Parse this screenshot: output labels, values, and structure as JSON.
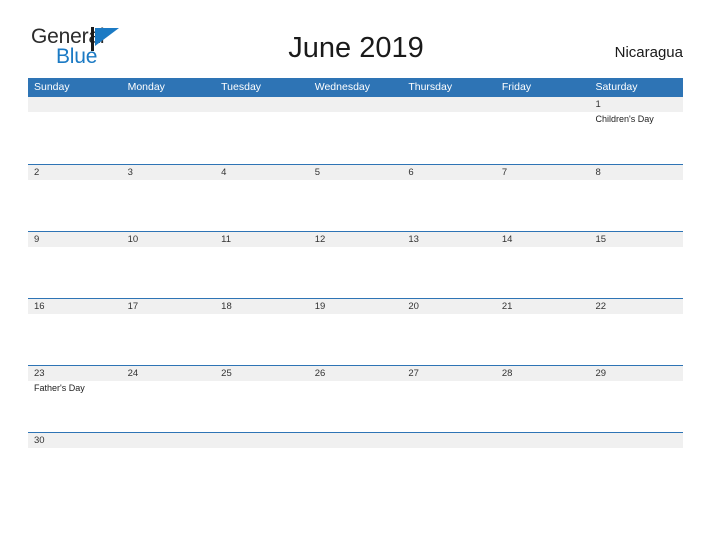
{
  "brand": {
    "name_part1": "General",
    "name_part2": "Blue",
    "flag_icon": "blue-pennant-flag-icon",
    "color_primary": "#1b7ac4",
    "color_text": "#2b2b2b"
  },
  "header": {
    "title": "June 2019",
    "country": "Nicaragua"
  },
  "theme": {
    "header_blue": "#2e74b5",
    "row_divider_blue": "#2e74b5",
    "daynum_band_gray": "#f0f0f0",
    "page_background": "#ffffff"
  },
  "calendar": {
    "month": "June",
    "year": "2019",
    "weekdays": [
      "Sunday",
      "Monday",
      "Tuesday",
      "Wednesday",
      "Thursday",
      "Friday",
      "Saturday"
    ],
    "weeks": [
      {
        "days": [
          {
            "num": "",
            "events": []
          },
          {
            "num": "",
            "events": []
          },
          {
            "num": "",
            "events": []
          },
          {
            "num": "",
            "events": []
          },
          {
            "num": "",
            "events": []
          },
          {
            "num": "",
            "events": []
          },
          {
            "num": "1",
            "events": [
              "Children's Day"
            ]
          }
        ]
      },
      {
        "days": [
          {
            "num": "2",
            "events": []
          },
          {
            "num": "3",
            "events": []
          },
          {
            "num": "4",
            "events": []
          },
          {
            "num": "5",
            "events": []
          },
          {
            "num": "6",
            "events": []
          },
          {
            "num": "7",
            "events": []
          },
          {
            "num": "8",
            "events": []
          }
        ]
      },
      {
        "days": [
          {
            "num": "9",
            "events": []
          },
          {
            "num": "10",
            "events": []
          },
          {
            "num": "11",
            "events": []
          },
          {
            "num": "12",
            "events": []
          },
          {
            "num": "13",
            "events": []
          },
          {
            "num": "14",
            "events": []
          },
          {
            "num": "15",
            "events": []
          }
        ]
      },
      {
        "days": [
          {
            "num": "16",
            "events": []
          },
          {
            "num": "17",
            "events": []
          },
          {
            "num": "18",
            "events": []
          },
          {
            "num": "19",
            "events": []
          },
          {
            "num": "20",
            "events": []
          },
          {
            "num": "21",
            "events": []
          },
          {
            "num": "22",
            "events": []
          }
        ]
      },
      {
        "days": [
          {
            "num": "23",
            "events": [
              "Father's Day"
            ]
          },
          {
            "num": "24",
            "events": []
          },
          {
            "num": "25",
            "events": []
          },
          {
            "num": "26",
            "events": []
          },
          {
            "num": "27",
            "events": []
          },
          {
            "num": "28",
            "events": []
          },
          {
            "num": "29",
            "events": []
          }
        ]
      },
      {
        "days": [
          {
            "num": "30",
            "events": []
          },
          {
            "num": "",
            "events": []
          },
          {
            "num": "",
            "events": []
          },
          {
            "num": "",
            "events": []
          },
          {
            "num": "",
            "events": []
          },
          {
            "num": "",
            "events": []
          },
          {
            "num": "",
            "events": []
          }
        ]
      }
    ]
  }
}
